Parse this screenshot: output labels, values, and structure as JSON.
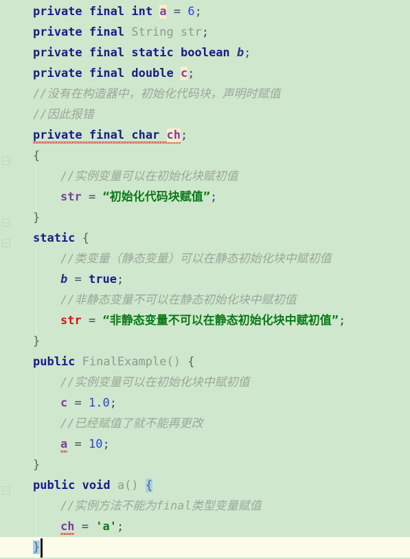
{
  "editor": {
    "background_color": "#cfe7cc",
    "current_line_color": "#fdfbe9",
    "language": "Java",
    "class_name": "FinalExample",
    "caret_line": 27,
    "caret_column": 2
  },
  "colors": {
    "keyword": "#1a1a8c",
    "class": "#8d9a8d",
    "identifier": "#8d9a8d",
    "instance_field": "#7c3f9e",
    "static_field": "#2e2a8e",
    "error": "#d81414",
    "number": "#2b44d8",
    "string": "#0a7a18",
    "comment": "#9aa79a",
    "identifier_highlight": "#fbeccd",
    "brace_match_highlight": "#aacdf2",
    "error_squiggle": "#e24b4b"
  },
  "lines": [
    {
      "n": 1,
      "indent": 0,
      "text": "private final int a = 6;"
    },
    {
      "n": 2,
      "indent": 0,
      "text": "private final String str;"
    },
    {
      "n": 3,
      "indent": 0,
      "text": "private final static boolean b;"
    },
    {
      "n": 4,
      "indent": 0,
      "text": "private final double c;"
    },
    {
      "n": 5,
      "indent": 0,
      "text": "//没有在构造器中，初始化代码块，声明时赋值"
    },
    {
      "n": 6,
      "indent": 0,
      "text": "//因此报错"
    },
    {
      "n": 7,
      "indent": 0,
      "text": "private final char ch;"
    },
    {
      "n": 8,
      "indent": 0,
      "text": "{"
    },
    {
      "n": 9,
      "indent": 1,
      "text": "//实例变量可以在初始化块赋初值"
    },
    {
      "n": 10,
      "indent": 1,
      "text": "str = “初始化代码块赋值”;"
    },
    {
      "n": 11,
      "indent": 0,
      "text": "}"
    },
    {
      "n": 12,
      "indent": 0,
      "text": "static {"
    },
    {
      "n": 13,
      "indent": 1,
      "text": "//类变量（静态变量）可以在静态初始化块中赋初值"
    },
    {
      "n": 14,
      "indent": 1,
      "text": "b = true;"
    },
    {
      "n": 15,
      "indent": 1,
      "text": "//非静态变量不可以在静态初始化块中赋初值"
    },
    {
      "n": 16,
      "indent": 1,
      "text": "str = “非静态变量不可以在静态初始化块中赋初值”;"
    },
    {
      "n": 17,
      "indent": 0,
      "text": "}"
    },
    {
      "n": 18,
      "indent": 0,
      "text": "public FinalExample() {"
    },
    {
      "n": 19,
      "indent": 1,
      "text": "//实例变量可以在初始化块中赋初值"
    },
    {
      "n": 20,
      "indent": 1,
      "text": "c = 1.0;"
    },
    {
      "n": 21,
      "indent": 1,
      "text": "//已经赋值了就不能再更改"
    },
    {
      "n": 22,
      "indent": 1,
      "text": "a = 10;"
    },
    {
      "n": 23,
      "indent": 0,
      "text": "}"
    },
    {
      "n": 24,
      "indent": 0,
      "text": "public void a() {"
    },
    {
      "n": 25,
      "indent": 1,
      "text": "//实例方法不能为final类型变量赋值"
    },
    {
      "n": 26,
      "indent": 1,
      "text": "ch = 'a';"
    },
    {
      "n": 27,
      "indent": 0,
      "text": "}"
    }
  ],
  "tokens": {
    "kw_private": "private",
    "kw_final": "final",
    "kw_static": "static",
    "kw_public": "public",
    "kw_void": "void",
    "kw_int": "int",
    "kw_boolean": "boolean",
    "kw_double": "double",
    "kw_char": "char",
    "kw_true": "true",
    "type_String": "String",
    "var_a": "a",
    "var_b": "b",
    "var_c": "c",
    "var_ch": "ch",
    "var_str": "str",
    "ctor_name": "FinalExample",
    "method_a": "a",
    "num_6": "6",
    "num_10": "10",
    "num_1_0": "1.0",
    "char_a": "'a'",
    "str_init_block": "“初始化代码块赋值”",
    "str_static_err": "“非静态变量不可以在静态初始化块中赋初值”",
    "cmt_5": "//没有在构造器中，初始化代码块，声明时赋值",
    "cmt_6": "//因此报错",
    "cmt_9": "//实例变量可以在初始化块赋初值",
    "cmt_13": "//类变量（静态变量）可以在静态初始化块中赋初值",
    "cmt_15": "//非静态变量不可以在静态初始化块中赋初值",
    "cmt_19": "//实例变量可以在初始化块中赋初值",
    "cmt_21": "//已经赋值了就不能再更改",
    "cmt_25": "//实例方法不能为final类型变量赋值",
    "eq": "=",
    "semi": ";",
    "brace_open": "{",
    "brace_close": "}",
    "parens": "()"
  }
}
